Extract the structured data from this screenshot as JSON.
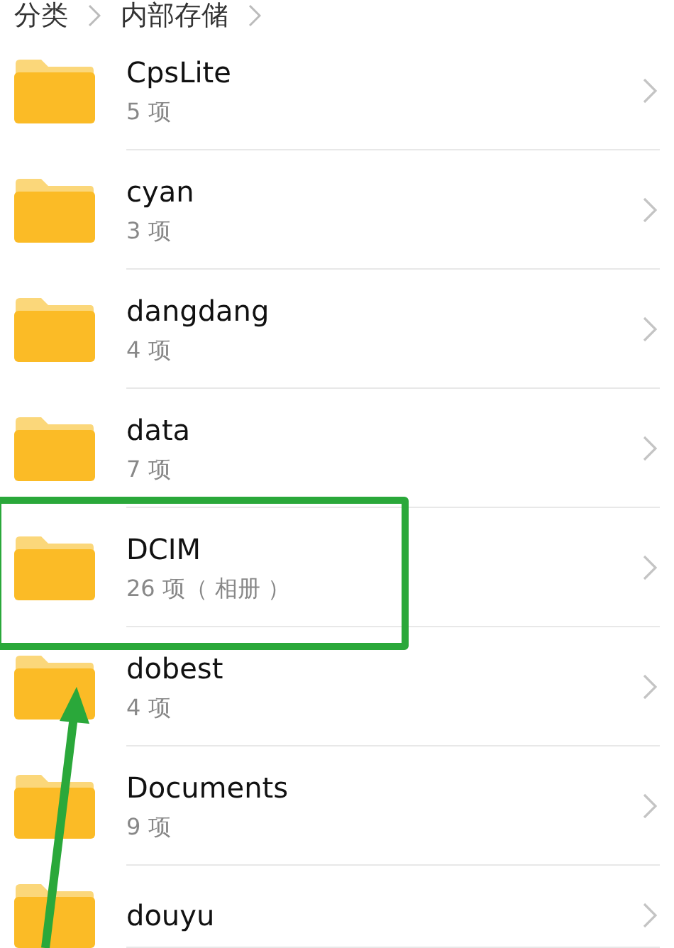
{
  "breadcrumb": [
    "分类",
    "内部存储"
  ],
  "folders": [
    {
      "name": "CpsLite",
      "count": "5 项",
      "highlighted": false
    },
    {
      "name": "cyan",
      "count": "3 项",
      "highlighted": false
    },
    {
      "name": "dangdang",
      "count": "4 项",
      "highlighted": false
    },
    {
      "name": "data",
      "count": "7 项",
      "highlighted": false
    },
    {
      "name": "DCIM",
      "count": "26 项（ 相册 ）",
      "highlighted": true
    },
    {
      "name": "dobest",
      "count": "4 项",
      "highlighted": false
    },
    {
      "name": "Documents",
      "count": "9 项",
      "highlighted": false
    },
    {
      "name": "douyu",
      "highlighted": false
    }
  ]
}
